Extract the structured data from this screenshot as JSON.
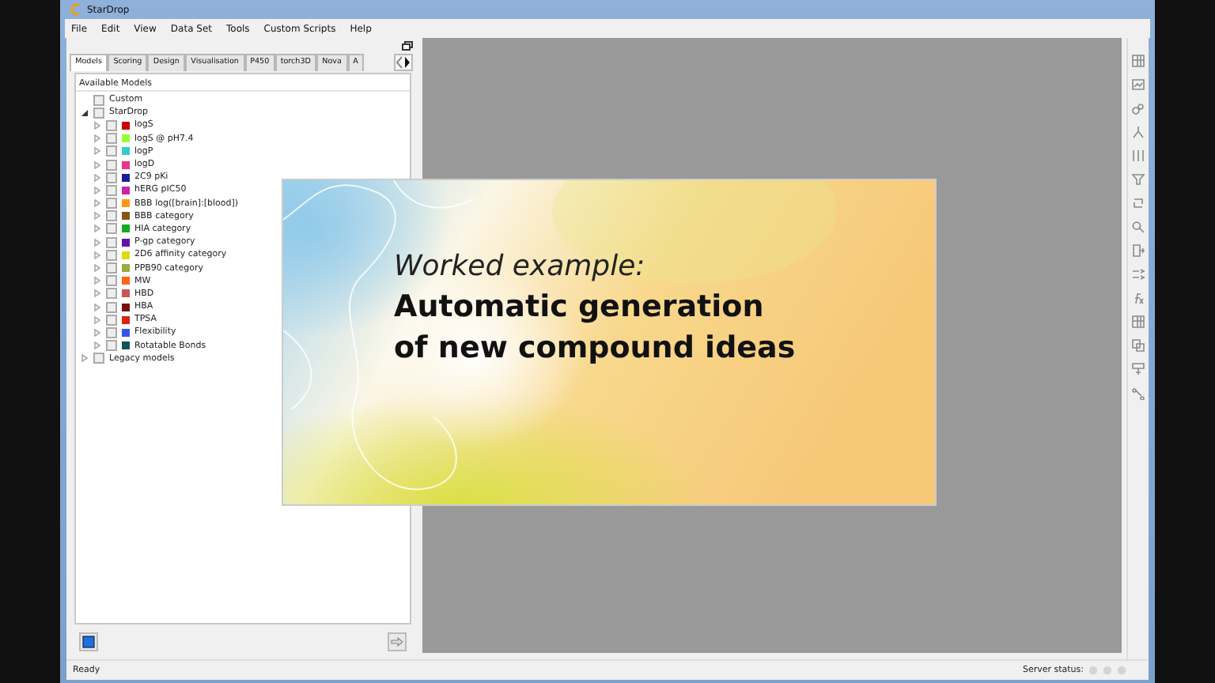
{
  "window": {
    "title": "StarDrop"
  },
  "menu": [
    "File",
    "Edit",
    "View",
    "Data Set",
    "Tools",
    "Custom Scripts",
    "Help"
  ],
  "tabs": [
    {
      "label": "Models",
      "selected": true
    },
    {
      "label": "Scoring",
      "selected": false
    },
    {
      "label": "Design",
      "selected": false
    },
    {
      "label": "Visualisation",
      "selected": false
    },
    {
      "label": "P450",
      "selected": false
    },
    {
      "label": "torch3D",
      "selected": false
    },
    {
      "label": "Nova",
      "selected": false
    },
    {
      "label": "A",
      "selected": false
    }
  ],
  "models_panel": {
    "title": "Available Models",
    "tree": [
      {
        "label": "Custom",
        "checked": false
      },
      {
        "label": "StarDrop",
        "checked": false,
        "expanded": true,
        "children": [
          {
            "label": "logS",
            "checked": false,
            "expanded": false,
            "color": "#cc0000"
          },
          {
            "label": "logS @ pH7.4",
            "checked": false,
            "expanded": false,
            "color": "#99ff33"
          },
          {
            "label": "logP",
            "checked": false,
            "expanded": false,
            "color": "#33cccc"
          },
          {
            "label": "logD",
            "checked": false,
            "expanded": false,
            "color": "#ee3388"
          },
          {
            "label": "2C9 pKi",
            "checked": false,
            "expanded": false,
            "color": "#1a1a99"
          },
          {
            "label": "hERG pIC50",
            "checked": false,
            "expanded": false,
            "color": "#cc22aa"
          },
          {
            "label": "BBB log([brain]:[blood])",
            "checked": false,
            "expanded": false,
            "color": "#ff9911"
          },
          {
            "label": "BBB category",
            "checked": false,
            "expanded": false,
            "color": "#885511"
          },
          {
            "label": "HIA category",
            "checked": false,
            "expanded": false,
            "color": "#11aa22"
          },
          {
            "label": "P-gp category",
            "checked": false,
            "expanded": false,
            "color": "#6611aa"
          },
          {
            "label": "2D6 affinity category",
            "checked": false,
            "expanded": false,
            "color": "#dddd11"
          },
          {
            "label": "PPB90 category",
            "checked": false,
            "expanded": false,
            "color": "#99aa44"
          },
          {
            "label": "MW",
            "checked": false,
            "expanded": false,
            "color": "#ff6611"
          },
          {
            "label": "HBD",
            "checked": false,
            "expanded": false,
            "color": "#cc5555"
          },
          {
            "label": "HBA",
            "checked": false,
            "expanded": false,
            "color": "#771111"
          },
          {
            "label": "TPSA",
            "checked": false,
            "expanded": false,
            "color": "#dd2211"
          },
          {
            "label": "Flexibility",
            "checked": false,
            "expanded": false,
            "color": "#3355ee"
          },
          {
            "label": "Rotatable Bonds",
            "checked": false,
            "expanded": false,
            "color": "#115555"
          }
        ]
      },
      {
        "label": "Legacy models",
        "checked": false,
        "expanded": false
      }
    ]
  },
  "status_bar": {
    "text": "Ready",
    "server_label": "Server status:"
  },
  "slide": {
    "subtitle": "Worked example:",
    "title_lines": [
      "Automatic generation",
      "of new compound ideas"
    ]
  }
}
